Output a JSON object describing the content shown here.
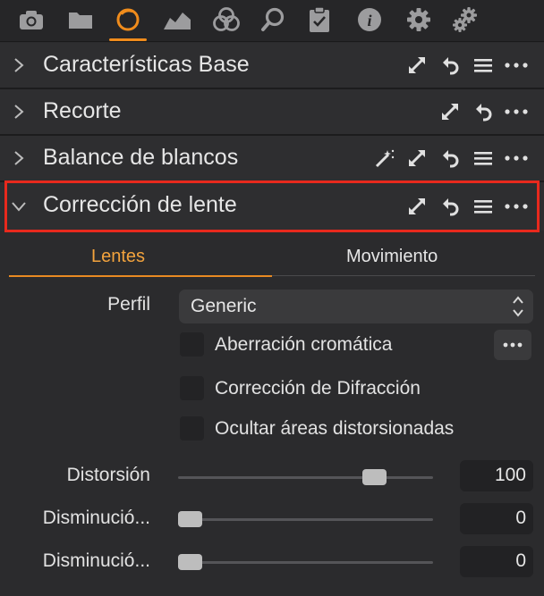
{
  "toolbar": {
    "tools": [
      "camera-icon",
      "folder-icon",
      "lens-icon",
      "histogram-icon",
      "color-icon",
      "search-icon",
      "clipboard-icon",
      "info-icon",
      "gear-icon",
      "gears-icon"
    ],
    "active_tool": "lens-icon",
    "accent_color": "#f08c1c"
  },
  "sections": [
    {
      "title": "Características Base",
      "expanded": false
    },
    {
      "title": "Recorte",
      "expanded": false
    },
    {
      "title": "Balance de blancos",
      "expanded": false
    },
    {
      "title": "Corrección de lente",
      "expanded": true,
      "highlighted": true
    }
  ],
  "lens": {
    "tabs": [
      {
        "label": "Lentes",
        "active": true
      },
      {
        "label": "Movimiento",
        "active": false
      }
    ],
    "profile_label": "Perfil",
    "profile_value": "Generic",
    "checkboxes": [
      {
        "label": "Aberración cromática",
        "checked": false
      },
      {
        "label": "Corrección de Difracción",
        "checked": false
      },
      {
        "label": "Ocultar áreas distorsionadas",
        "checked": false
      }
    ],
    "sliders": [
      {
        "label": "Distorsión",
        "value": "100",
        "level": 0.8
      },
      {
        "label": "Disminució...",
        "value": "0",
        "level": 0.0
      },
      {
        "label": "Disminució...",
        "value": "0",
        "level": 0.0
      }
    ]
  },
  "highlight_color": "#e8291d"
}
